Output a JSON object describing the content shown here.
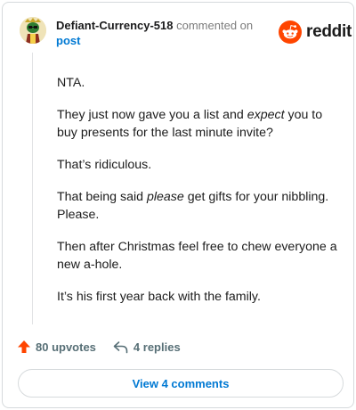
{
  "comment": {
    "author": "Defiant-Currency-518",
    "action_text": "commented on",
    "post_link": "post",
    "paragraphs": [
      [
        "NTA."
      ],
      [
        "They just now gave you a list and ",
        {
          "em": "expect"
        },
        " you to buy presents for the last minute invite?"
      ],
      [
        "That’s ridiculous."
      ],
      [
        "That being said ",
        {
          "em": "please"
        },
        " get gifts for your nibbling. Please."
      ],
      [
        "Then after Christmas feel free to chew everyone a new a-hole."
      ],
      [
        "It’s his first year back with the family."
      ]
    ]
  },
  "brand": {
    "wordmark": "reddit",
    "color": "#ff4500"
  },
  "actions": {
    "upvotes": "80 upvotes",
    "upvote_icon": "upvote-arrow-icon",
    "replies": "4 replies",
    "reply_icon": "reply-arrow-icon"
  },
  "view_comments_label": "View 4 comments",
  "colors": {
    "link": "#0079d3",
    "upvote": "#ff4500",
    "muted": "#576f76"
  }
}
